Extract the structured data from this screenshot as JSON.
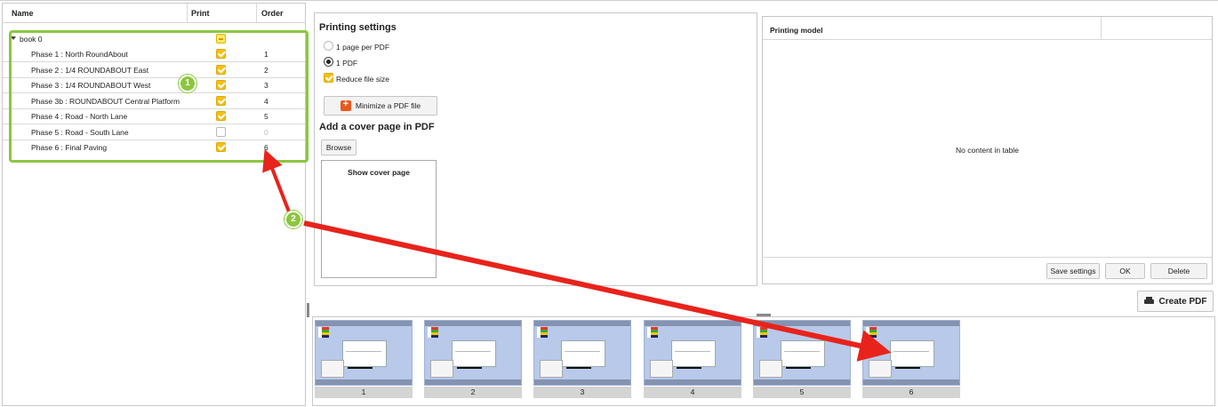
{
  "tree": {
    "columns": {
      "name": "Name",
      "print": "Print",
      "order": "Order"
    },
    "root": {
      "label": "book 0",
      "state": "mixed"
    },
    "rows": [
      {
        "label": "Phase 1 : North RoundAbout",
        "checked": true,
        "order": "1"
      },
      {
        "label": "Phase 2 : 1/4 ROUNDABOUT East",
        "checked": true,
        "order": "2"
      },
      {
        "label": "Phase 3 : 1/4 ROUNDABOUT West",
        "checked": true,
        "order": "3"
      },
      {
        "label": "Phase 3b : ROUNDABOUT Central Platform",
        "checked": true,
        "order": "4"
      },
      {
        "label": "Phase 4 : Road - North Lane",
        "checked": true,
        "order": "5"
      },
      {
        "label": "Phase 5 : Road - South Lane",
        "checked": false,
        "order": "0"
      },
      {
        "label": "Phase 6 : Final Paving",
        "checked": true,
        "order": "6"
      }
    ]
  },
  "printing": {
    "title": "Printing settings",
    "opt_page_per_pdf": "1 page per PDF",
    "opt_one_pdf": "1 PDF",
    "opt_reduce": "Reduce file size",
    "minimize_button": "Minimize a PDF file",
    "cover_title": "Add a cover page in PDF",
    "browse_button": "Browse",
    "show_cover": "Show cover page"
  },
  "model": {
    "header": "Printing model",
    "empty": "No content in table",
    "save_button": "Save settings",
    "ok_button": "OK",
    "delete_button": "Delete"
  },
  "create_pdf": "Create PDF",
  "thumbnails": [
    "1",
    "2",
    "3",
    "4",
    "5",
    "6"
  ],
  "annotations": {
    "badge1": "1",
    "badge2": "2",
    "green": "#8cc63f",
    "red": "#e8231b"
  },
  "icons": [
    "caret-down-icon",
    "pdf-minimize-icon",
    "printer-icon"
  ]
}
